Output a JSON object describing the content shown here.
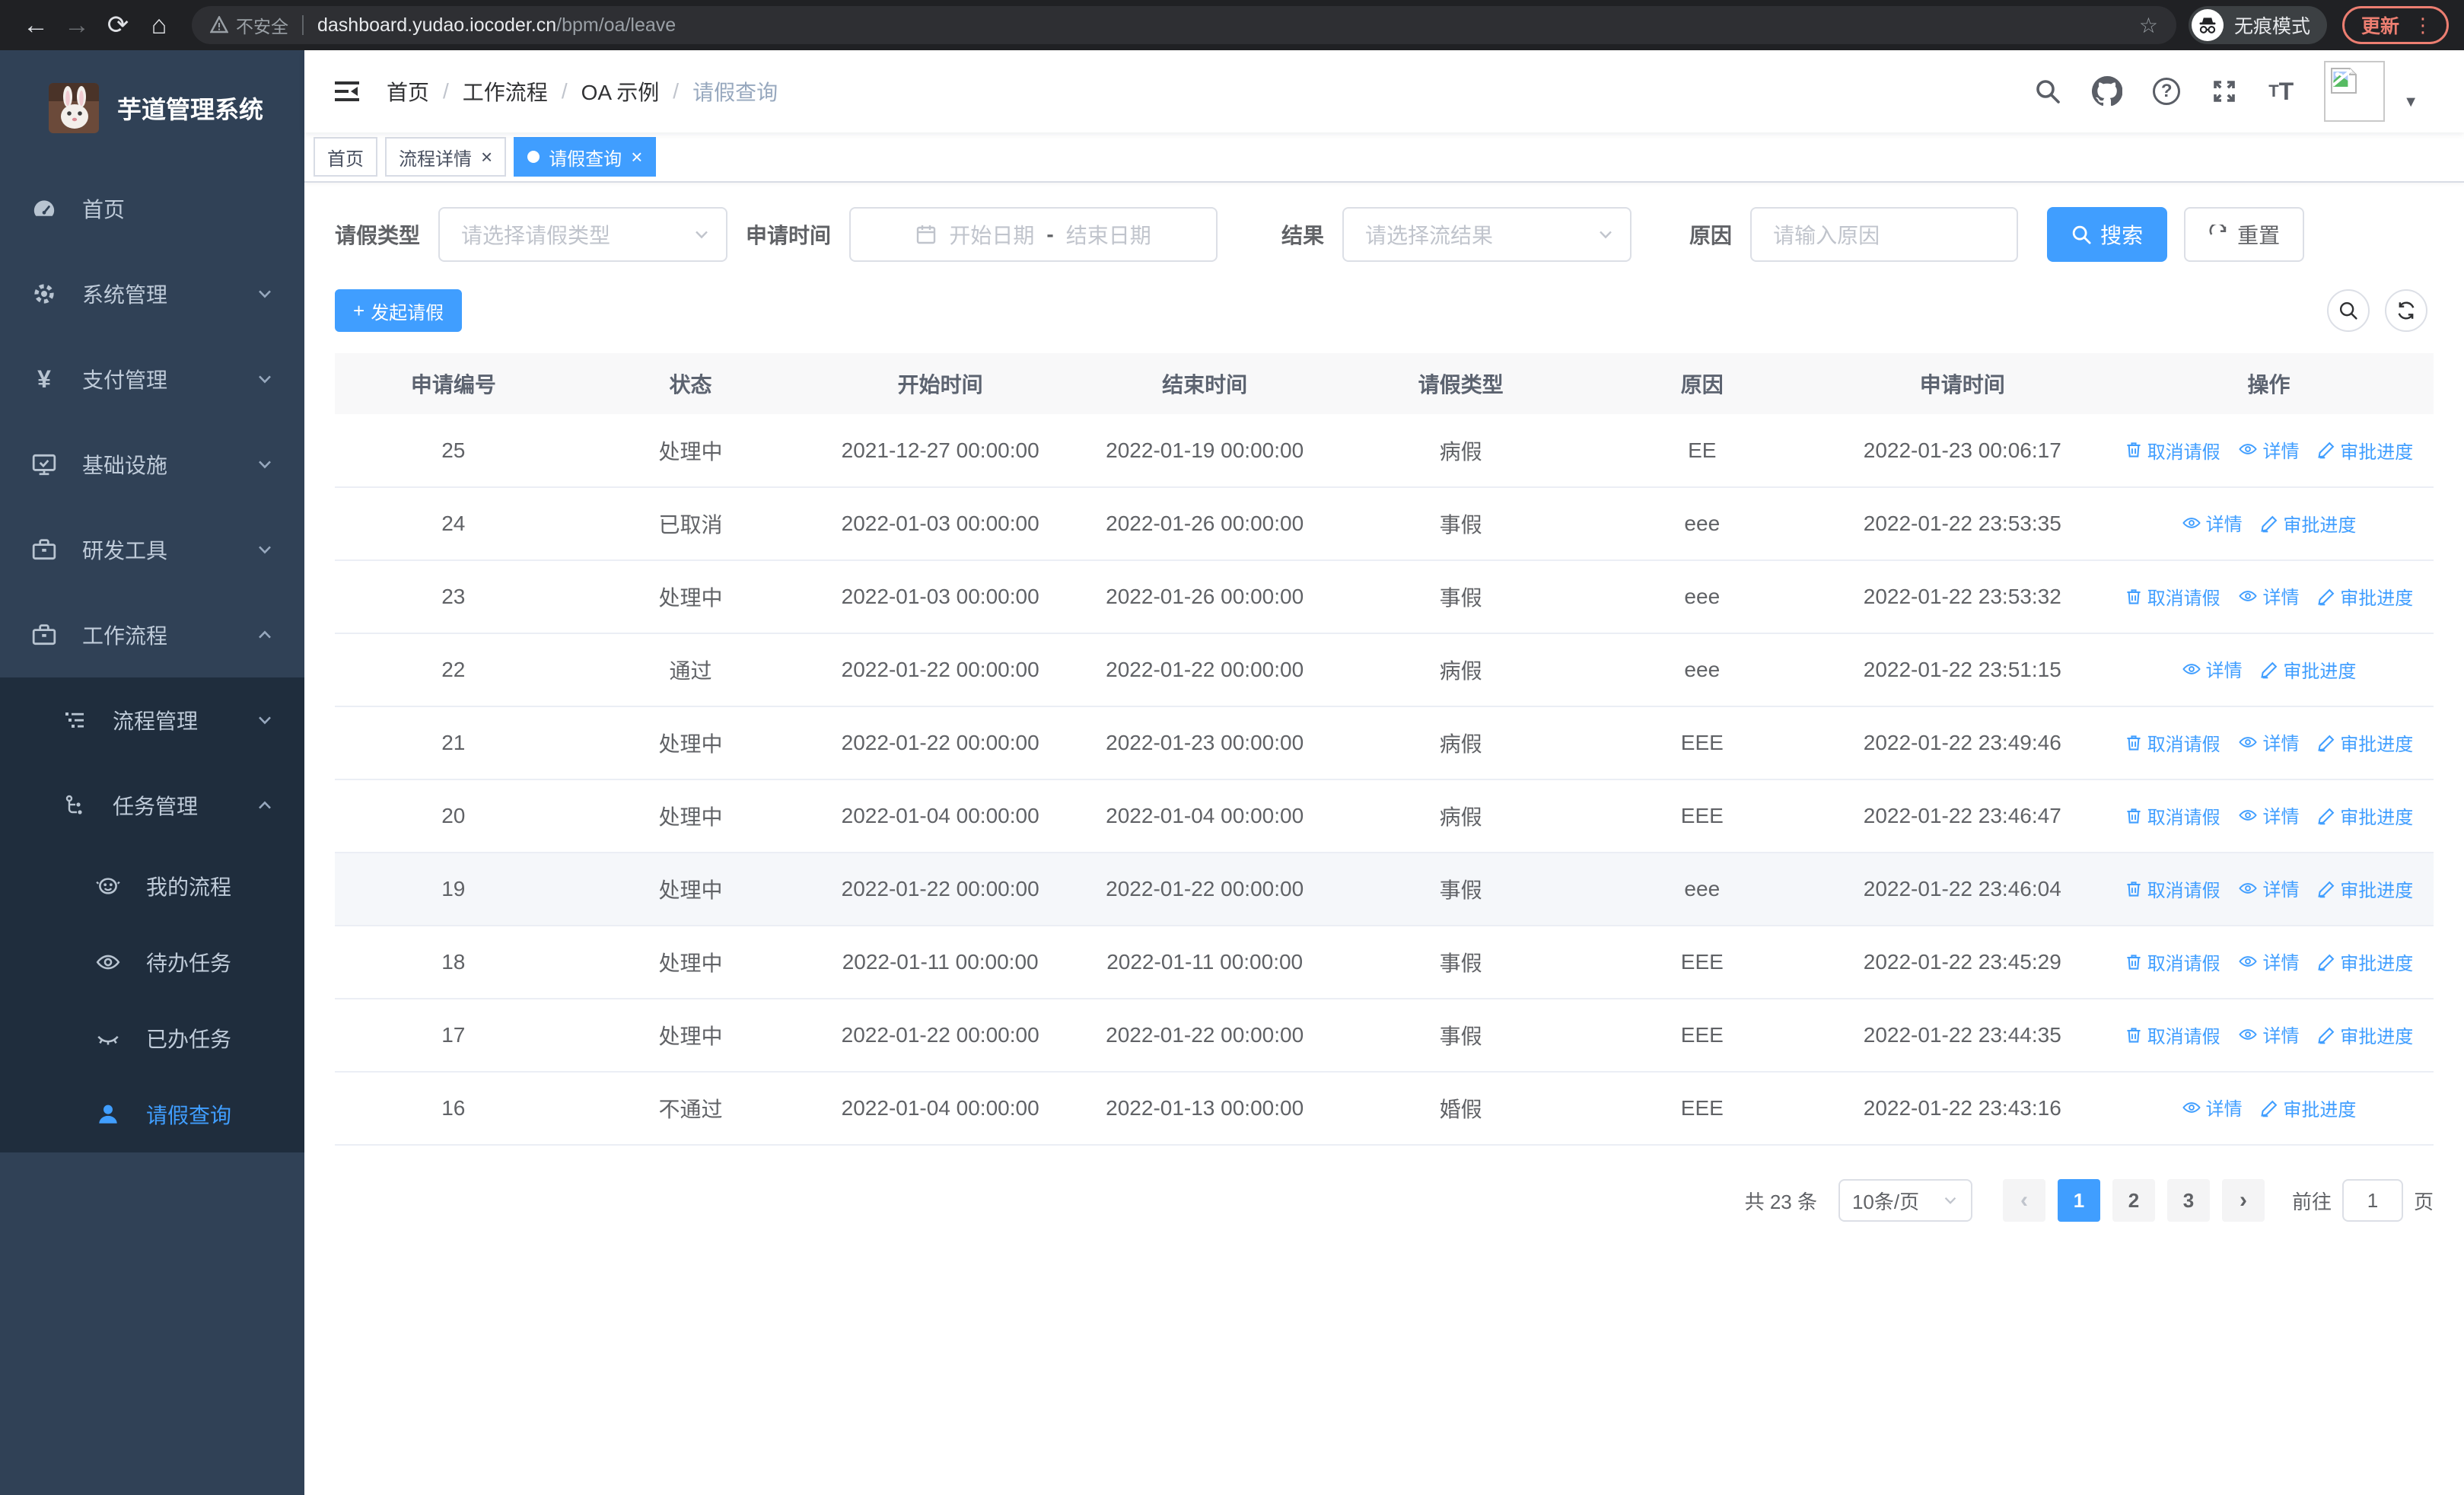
{
  "colors": {
    "accent": "#409EFF",
    "sidebar_bg": "#304156",
    "submenu_bg": "#1f2d3d",
    "update_pill": "#ec7e71"
  },
  "browser": {
    "security_label": "不安全",
    "url_host": "dashboard.yudao.iocoder.cn",
    "url_path": "/bpm/oa/leave",
    "incognito_label": "无痕模式",
    "update_label": "更新"
  },
  "sidebar": {
    "title": "芋道管理系统",
    "menu": [
      {
        "label": "首页"
      },
      {
        "label": "系统管理"
      },
      {
        "label": "支付管理"
      },
      {
        "label": "基础设施"
      },
      {
        "label": "研发工具"
      },
      {
        "label": "工作流程"
      },
      {
        "label": "流程管理"
      },
      {
        "label": "任务管理"
      },
      {
        "label": "我的流程"
      },
      {
        "label": "待办任务"
      },
      {
        "label": "已办任务"
      },
      {
        "label": "请假查询"
      }
    ]
  },
  "navbar": {
    "breadcrumb": [
      "首页",
      "工作流程",
      "OA 示例",
      "请假查询"
    ]
  },
  "tabs": [
    {
      "label": "首页"
    },
    {
      "label": "流程详情"
    },
    {
      "label": "请假查询"
    }
  ],
  "filters": {
    "leave_type_label": "请假类型",
    "leave_type_placeholder": "请选择请假类型",
    "apply_time_label": "申请时间",
    "date_start_placeholder": "开始日期",
    "date_separator": "-",
    "date_end_placeholder": "结束日期",
    "result_label": "结果",
    "result_placeholder": "请选择流结果",
    "reason_label": "原因",
    "reason_placeholder": "请输入原因",
    "search_label": "搜索",
    "reset_label": "重置"
  },
  "toolbar": {
    "create_label": "发起请假"
  },
  "table": {
    "columns": [
      "申请编号",
      "状态",
      "开始时间",
      "结束时间",
      "请假类型",
      "原因",
      "申请时间",
      "操作"
    ],
    "action_labels": {
      "cancel": "取消请假",
      "detail": "详情",
      "progress": "审批进度"
    },
    "rows": [
      {
        "id": "25",
        "status": "处理中",
        "start": "2021-12-27 00:00:00",
        "end": "2022-01-19 00:00:00",
        "type": "病假",
        "reason": "EE",
        "applied": "2022-01-23 00:06:17",
        "actions": [
          "cancel",
          "detail",
          "progress"
        ],
        "highlight": false
      },
      {
        "id": "24",
        "status": "已取消",
        "start": "2022-01-03 00:00:00",
        "end": "2022-01-26 00:00:00",
        "type": "事假",
        "reason": "eee",
        "applied": "2022-01-22 23:53:35",
        "actions": [
          "detail",
          "progress"
        ],
        "highlight": false
      },
      {
        "id": "23",
        "status": "处理中",
        "start": "2022-01-03 00:00:00",
        "end": "2022-01-26 00:00:00",
        "type": "事假",
        "reason": "eee",
        "applied": "2022-01-22 23:53:32",
        "actions": [
          "cancel",
          "detail",
          "progress"
        ],
        "highlight": false
      },
      {
        "id": "22",
        "status": "通过",
        "start": "2022-01-22 00:00:00",
        "end": "2022-01-22 00:00:00",
        "type": "病假",
        "reason": "eee",
        "applied": "2022-01-22 23:51:15",
        "actions": [
          "detail",
          "progress"
        ],
        "highlight": false
      },
      {
        "id": "21",
        "status": "处理中",
        "start": "2022-01-22 00:00:00",
        "end": "2022-01-23 00:00:00",
        "type": "病假",
        "reason": "EEE",
        "applied": "2022-01-22 23:49:46",
        "actions": [
          "cancel",
          "detail",
          "progress"
        ],
        "highlight": false
      },
      {
        "id": "20",
        "status": "处理中",
        "start": "2022-01-04 00:00:00",
        "end": "2022-01-04 00:00:00",
        "type": "病假",
        "reason": "EEE",
        "applied": "2022-01-22 23:46:47",
        "actions": [
          "cancel",
          "detail",
          "progress"
        ],
        "highlight": false
      },
      {
        "id": "19",
        "status": "处理中",
        "start": "2022-01-22 00:00:00",
        "end": "2022-01-22 00:00:00",
        "type": "事假",
        "reason": "eee",
        "applied": "2022-01-22 23:46:04",
        "actions": [
          "cancel",
          "detail",
          "progress"
        ],
        "highlight": true
      },
      {
        "id": "18",
        "status": "处理中",
        "start": "2022-01-11 00:00:00",
        "end": "2022-01-11 00:00:00",
        "type": "事假",
        "reason": "EEE",
        "applied": "2022-01-22 23:45:29",
        "actions": [
          "cancel",
          "detail",
          "progress"
        ],
        "highlight": false
      },
      {
        "id": "17",
        "status": "处理中",
        "start": "2022-01-22 00:00:00",
        "end": "2022-01-22 00:00:00",
        "type": "事假",
        "reason": "EEE",
        "applied": "2022-01-22 23:44:35",
        "actions": [
          "cancel",
          "detail",
          "progress"
        ],
        "highlight": false
      },
      {
        "id": "16",
        "status": "不通过",
        "start": "2022-01-04 00:00:00",
        "end": "2022-01-13 00:00:00",
        "type": "婚假",
        "reason": "EEE",
        "applied": "2022-01-22 23:43:16",
        "actions": [
          "detail",
          "progress"
        ],
        "highlight": false
      }
    ]
  },
  "pagination": {
    "total_label": "共 23 条",
    "page_size": "10条/页",
    "pages": [
      "1",
      "2",
      "3"
    ],
    "active_page": "1",
    "goto_label": "前往",
    "goto_value": "1",
    "page_unit": "页"
  }
}
